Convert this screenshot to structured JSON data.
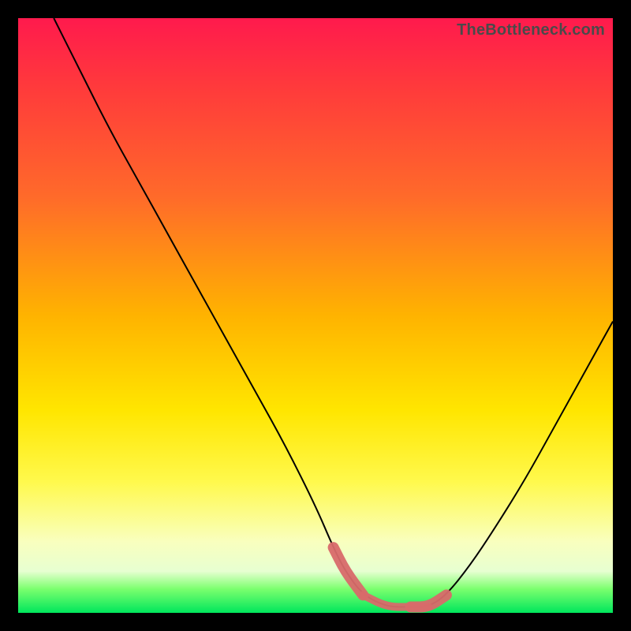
{
  "watermark": "TheBottleneck.com",
  "chart_data": {
    "type": "line",
    "title": "",
    "xlabel": "",
    "ylabel": "",
    "xlim": [
      0,
      100
    ],
    "ylim": [
      0,
      100
    ],
    "grid": false,
    "legend": false,
    "series": [
      {
        "name": "curve",
        "x": [
          6,
          10,
          15,
          20,
          25,
          30,
          35,
          40,
          45,
          50,
          53,
          55,
          58,
          62,
          66,
          69,
          72,
          76,
          80,
          85,
          90,
          95,
          100
        ],
        "values": [
          100,
          92,
          82,
          73,
          64,
          55,
          46,
          37,
          28,
          18,
          11,
          7,
          3,
          1,
          1,
          1,
          3,
          8,
          14,
          22,
          31,
          40,
          49
        ]
      }
    ],
    "highlight_range_x": [
      53,
      73
    ],
    "background_gradient": {
      "top": "#ff1a4d",
      "bottom": "#00e65c"
    }
  }
}
